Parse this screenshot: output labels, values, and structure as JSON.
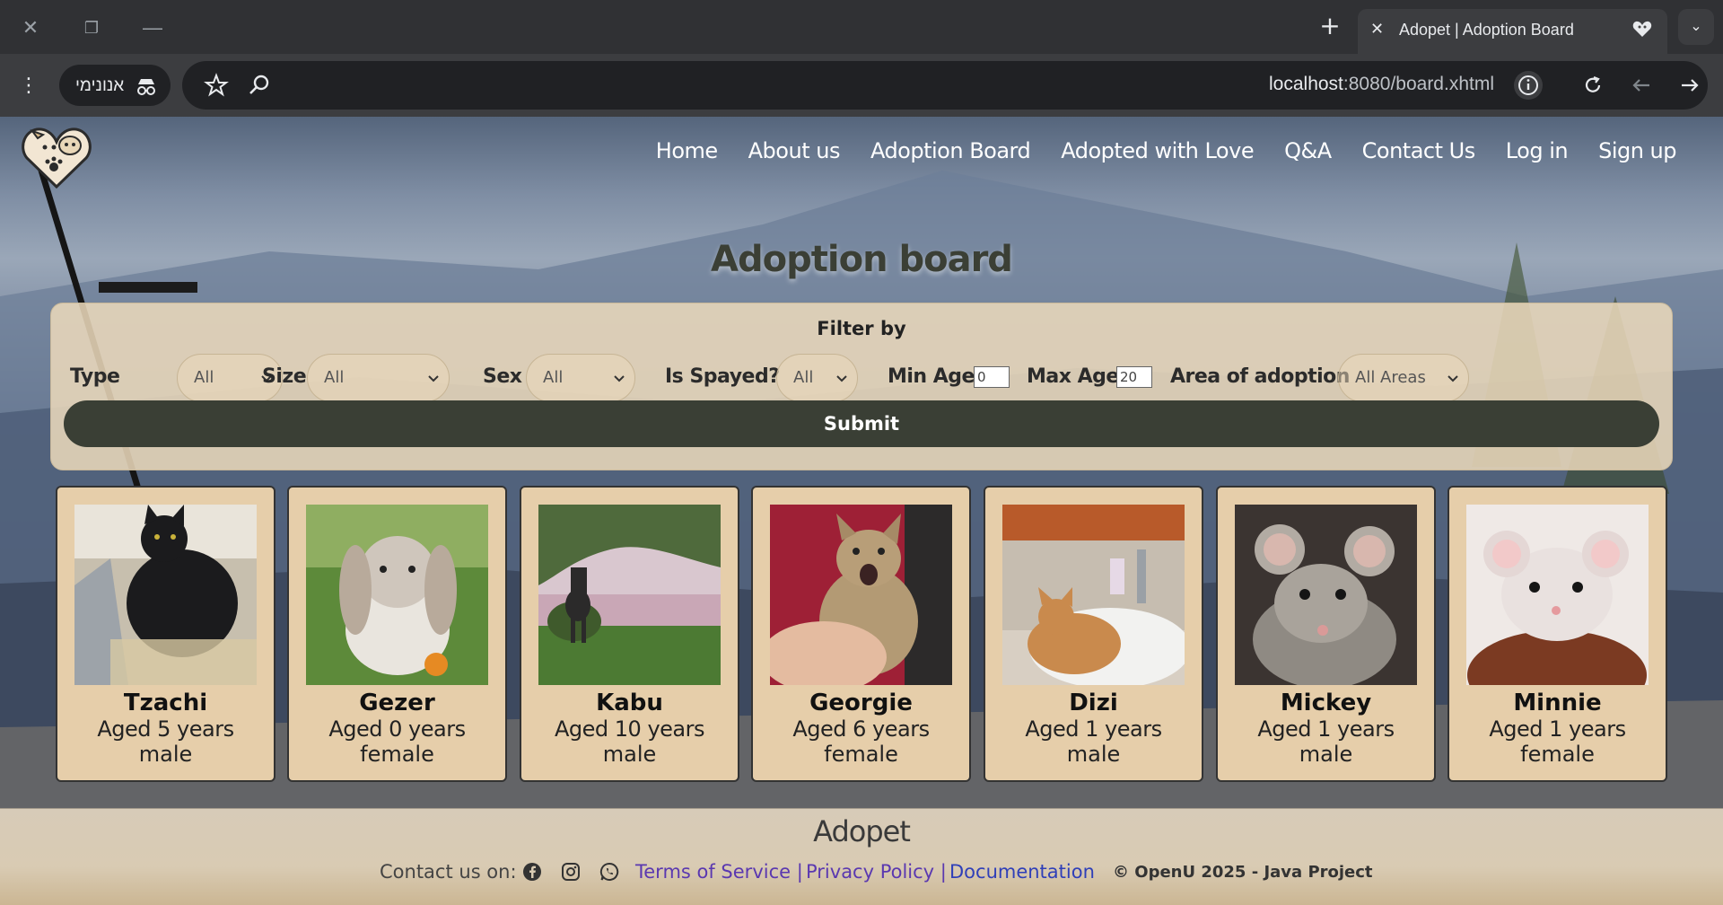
{
  "browser": {
    "tab_title": "Adopet | Adoption Board",
    "incognito_label": "אנונימי",
    "url_host": "localhost",
    "url_rest": ":8080/board.xhtml"
  },
  "nav": {
    "links": [
      "Home",
      "About us",
      "Adoption Board",
      "Adopted with Love",
      "Q&A",
      "Contact Us",
      "Log in",
      "Sign up"
    ]
  },
  "page": {
    "title": "Adoption board"
  },
  "filter": {
    "heading": "Filter by",
    "type_label": "Type",
    "type_value": "All",
    "size_label": "Size",
    "size_value": "All",
    "sex_label": "Sex",
    "sex_value": "All",
    "spayed_label": "Is Spayed?",
    "spayed_value": "All",
    "min_age_label": "Min Age",
    "min_age_value": "0",
    "max_age_label": "Max Age",
    "max_age_value": "20",
    "area_label": "Area of adoption",
    "area_value": "All Areas",
    "submit_label": "Submit"
  },
  "pets": [
    {
      "name": "Tzachi",
      "age": "Aged 5 years",
      "sex": "male",
      "photo": "black-cat"
    },
    {
      "name": "Gezer",
      "age": "Aged 0 years",
      "sex": "female",
      "photo": "lop-rabbit"
    },
    {
      "name": "Kabu",
      "age": "Aged 10 years",
      "sex": "male",
      "photo": "husky-dog"
    },
    {
      "name": "Georgie",
      "age": "Aged 6 years",
      "sex": "female",
      "photo": "tabby-cat"
    },
    {
      "name": "Dizi",
      "age": "Aged 1 years",
      "sex": "male",
      "photo": "ginger-cat-in-sink"
    },
    {
      "name": "Mickey",
      "age": "Aged 1 years",
      "sex": "male",
      "photo": "grey-mouse"
    },
    {
      "name": "Minnie",
      "age": "Aged 1 years",
      "sex": "female",
      "photo": "white-mouse"
    }
  ],
  "footer": {
    "brand": "Adopet",
    "contact_label": "Contact us on:",
    "terms": "Terms of Service |",
    "privacy": "Privacy Policy |",
    "docs": "Documentation",
    "copyright": "© OpenU 2025 - Java Project"
  },
  "colors": {
    "panel": "#ecdabc",
    "card": "#e6ceaa",
    "button": "#3a3f35",
    "link": "#5a38b0"
  }
}
